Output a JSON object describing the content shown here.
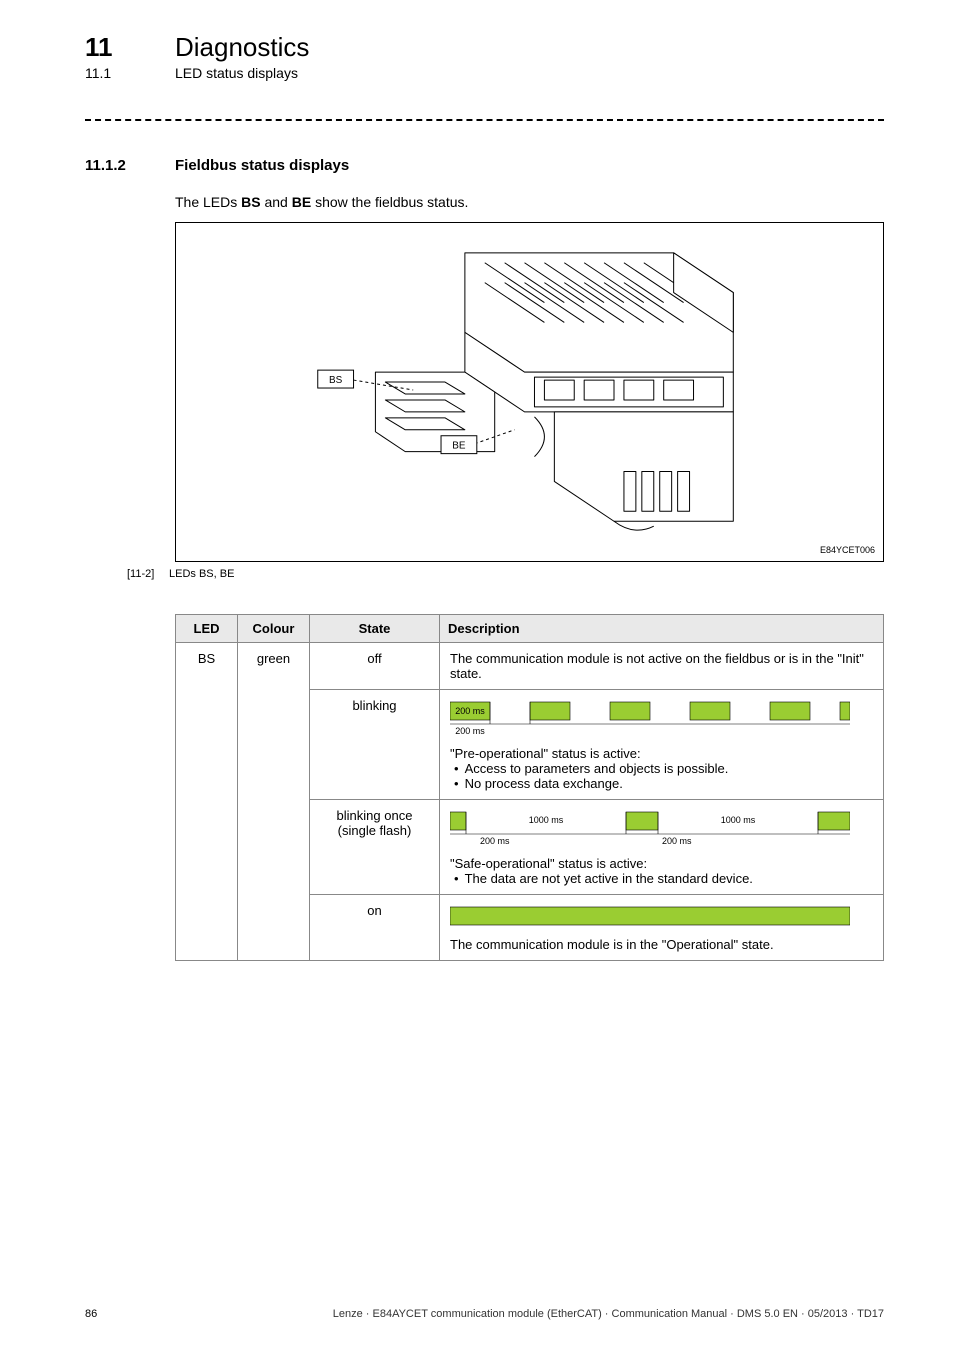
{
  "chapter": {
    "num": "11",
    "title": "Diagnostics"
  },
  "section": {
    "num": "11.1",
    "title": "LED status displays"
  },
  "subsection": {
    "num": "11.1.2",
    "title": "Fieldbus status displays"
  },
  "intro": {
    "prefix": "The LEDs ",
    "b1": "BS",
    "mid": " and ",
    "b2": "BE",
    "suffix": " show the fieldbus status."
  },
  "figure": {
    "code": "E84YCET006",
    "label_bs": "BS",
    "label_be": "BE",
    "cap_num": "[11-2]",
    "cap_text": "LEDs BS, BE"
  },
  "table": {
    "headers": {
      "led": "LED",
      "colour": "Colour",
      "state": "State",
      "desc": "Description"
    },
    "led_name": "BS",
    "colour": "green",
    "rows": {
      "off": {
        "state": "off",
        "desc": "The communication module is not active on the fieldbus or is in the \"Init\" state."
      },
      "blinking": {
        "state": "blinking",
        "timing": {
          "on": "200 ms",
          "period": "200 ms"
        },
        "line": "\"Pre-operational\" status is active:",
        "bullets": [
          "Access to parameters and objects is possible.",
          "No process data exchange."
        ]
      },
      "single": {
        "state1": "blinking once",
        "state2": "(single flash)",
        "timing": {
          "off1": "1000 ms",
          "on": "200 ms",
          "off1b": "1000 ms",
          "on2": "200 ms"
        },
        "line": "\"Safe-operational\" status is active:",
        "bullets": [
          "The data are not yet active in the standard device."
        ]
      },
      "on": {
        "state": "on",
        "desc": "The communication module is in the \"Operational\" state."
      }
    }
  },
  "footer": {
    "page": "86",
    "text": "Lenze · E84AYCET communication module (EtherCAT) · Communication Manual · DMS 5.0 EN · 05/2013 · TD17"
  },
  "chart_data": [
    {
      "type": "table",
      "title": "LED BS status",
      "columns": [
        "LED",
        "Colour",
        "State",
        "Description"
      ],
      "rows": [
        [
          "BS",
          "green",
          "off",
          "Not active on fieldbus / Init state"
        ],
        [
          "BS",
          "green",
          "blinking 200ms/200ms",
          "Pre-operational: parameter access possible, no process data exchange"
        ],
        [
          "BS",
          "green",
          "single flash 200ms on / 1000ms off",
          "Safe-operational: data not yet active in standard device"
        ],
        [
          "BS",
          "green",
          "on",
          "Operational state"
        ]
      ]
    }
  ]
}
